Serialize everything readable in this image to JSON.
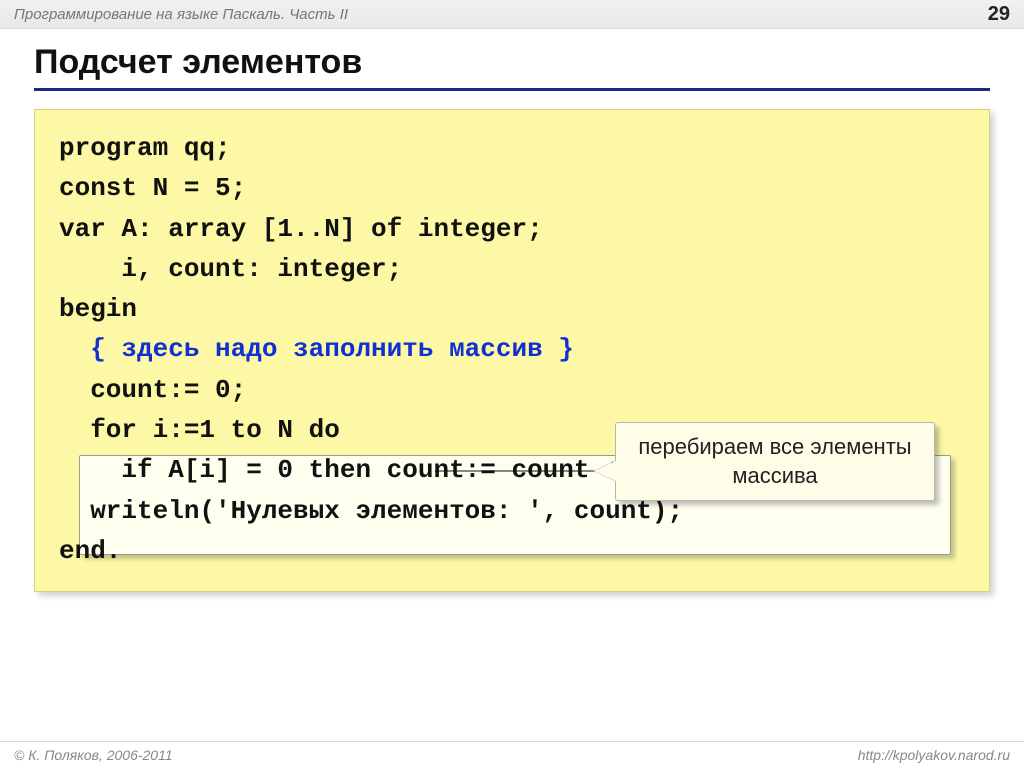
{
  "header": {
    "subject": "Программирование на языке Паскаль. Часть II",
    "page_number": "29"
  },
  "title": "Подсчет элементов",
  "code": {
    "l1": "program qq;",
    "l2": "const N = 5;",
    "l3": "var A: array [1..N] of integer;",
    "l4": "    i, count: integer;",
    "l5": "begin",
    "l6": "  { здесь надо заполнить массив }",
    "l7": "  count:= 0;",
    "l8": "  for i:=1 to N do",
    "l9": "    if A[i] = 0 then count:= count + 1;",
    "l10": "  writeln('Нулевых элементов: ', count);",
    "l11": "end."
  },
  "annotation": "перебираем все элементы массива",
  "footer": {
    "author": "© К. Поляков, 2006-2011",
    "url": "http://kpolyakov.narod.ru"
  }
}
